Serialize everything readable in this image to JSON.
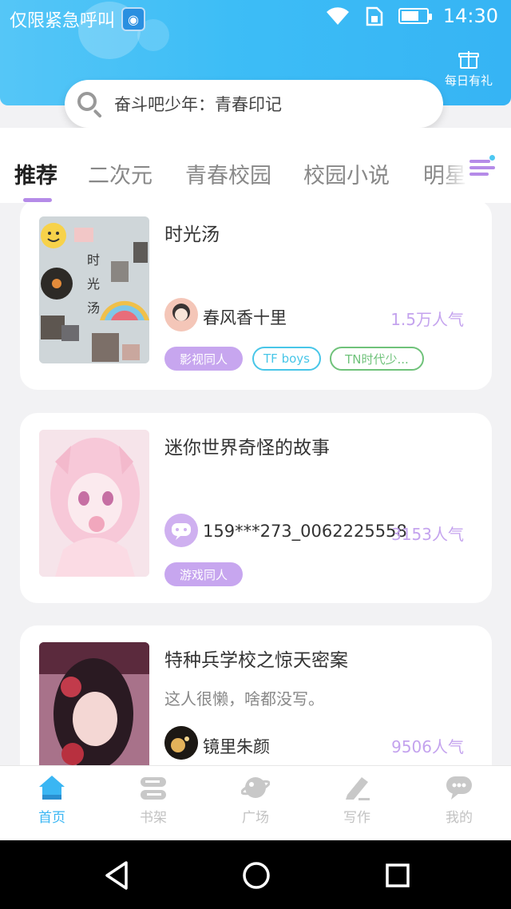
{
  "status_bar": {
    "carrier_text": "仅限紧急呼叫",
    "app_icon_glyph": "◉",
    "time": "14:30",
    "battery_level": 0.7,
    "icons": [
      "wifi-icon",
      "sim-icon",
      "battery-icon"
    ]
  },
  "header": {
    "gift_label": "每日有礼",
    "search_text": "奋斗吧少年：青春印记"
  },
  "tabs": {
    "items": [
      "推荐",
      "二次元",
      "青春校园",
      "校园小说",
      "明星"
    ],
    "active_index": 0
  },
  "feed": [
    {
      "title": "时光汤",
      "description": "",
      "author": "春风香十里",
      "popularity": "1.5万人气",
      "tags": [
        "影视同人",
        "TF boys",
        "TN时代少..."
      ],
      "cover_text": "时\n光\n汤"
    },
    {
      "title": "迷你世界奇怪的故事",
      "description": "",
      "author": "159***273_0062225558",
      "popularity": "3153人气",
      "tags": [
        "游戏同人"
      ]
    },
    {
      "title": "特种兵学校之惊天密案",
      "description": "这人很懒，啥都没写。",
      "author": "镜里朱颜",
      "popularity": "9506人气",
      "tags": []
    }
  ],
  "bottom_nav": {
    "items": [
      "首页",
      "书架",
      "广场",
      "写作",
      "我的"
    ],
    "active_index": 0
  },
  "colors": {
    "header_blue": "#3dbdf6",
    "accent_purple": "#c4a3ee",
    "tag_purple": "#c7a6ef",
    "tag_cyan": "#48c6e8",
    "tag_green": "#6fc27a",
    "nav_active": "#3ab6f3"
  }
}
